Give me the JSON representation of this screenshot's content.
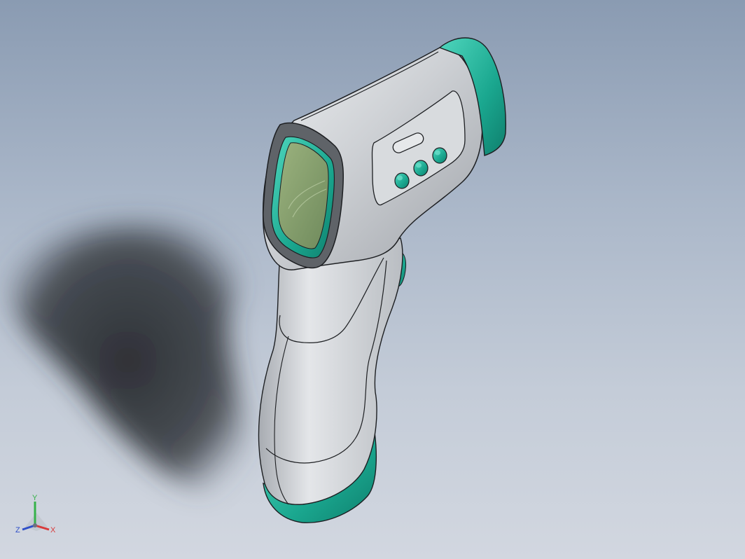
{
  "viewport": {
    "background_top": "#8a9bb2",
    "background_bottom": "#d2d7e0"
  },
  "model": {
    "body_color": "#cfd2d6",
    "accent_color": "#1bb39a",
    "screen_color": "#7e9a68",
    "outline_color": "#1d1f22"
  },
  "triad": {
    "x_label": "X",
    "y_label": "Y",
    "z_label": "Z",
    "x_color": "#d93a3a",
    "y_color": "#36b24a",
    "z_color": "#2f4fc8"
  }
}
